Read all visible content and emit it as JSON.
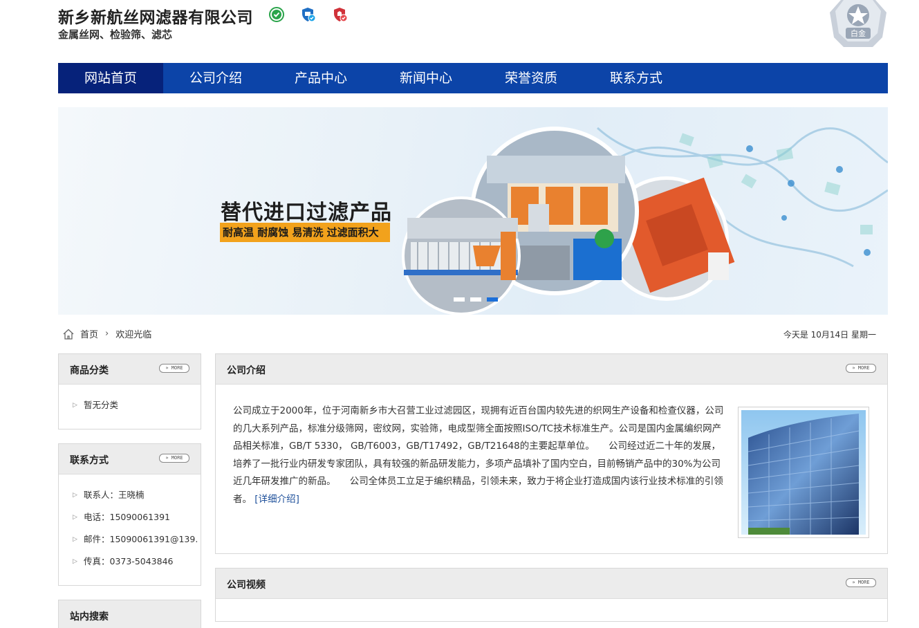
{
  "header": {
    "company_name": "新乡新航丝网滤器有限公司",
    "company_sub": "金属丝网、检验筛、滤芯",
    "badges": [
      "verified-green-icon",
      "shield-blue-icon",
      "shield-red-icon"
    ],
    "level_badge": "白金"
  },
  "nav": {
    "items": [
      {
        "label": "网站首页",
        "active": true
      },
      {
        "label": "公司介绍"
      },
      {
        "label": "产品中心"
      },
      {
        "label": "新闻中心"
      },
      {
        "label": "荣誉资质"
      },
      {
        "label": "联系方式"
      }
    ]
  },
  "banner": {
    "title": "替代进口过滤产品",
    "tagline": "耐高温 耐腐蚀 易清洗 过滤面积大",
    "slides_total": 3,
    "active_slide": 3
  },
  "breadcrumb": {
    "home": "首页",
    "current": "欢迎光临"
  },
  "date_text": "今天是 10月14日 星期一",
  "more_label": "MORE",
  "sidebar": {
    "categories": {
      "title": "商品分类",
      "items": [
        "暂无分类"
      ]
    },
    "contact": {
      "title": "联系方式",
      "items": [
        "联系人：王晓楠",
        "电话：15090061391",
        "邮件：15090061391@139.",
        "传真：0373-5043846"
      ]
    },
    "search": {
      "title": "站内搜索"
    }
  },
  "main": {
    "intro": {
      "title": "公司介绍",
      "text": "公司成立于2000年，位于河南新乡市大召营工业过滤园区，现拥有近百台国内较先进的织网生产设备和检查仪器，公司的几大系列产品，标准分级筛网，密纹网，实验筛，电成型筛全面按照ISO/TC技术标准生产。公司是国内金属编织网产品相关标准，GB/T 5330， GB/T6003，GB/T17492，GB/T21648的主要起草单位。　　公司经过近二十年的发展，培养了一批行业内研发专家团队，具有较强的新品研发能力，多项产品填补了国内空白，目前畅销产品中的30%为公司近几年研发推广的新品。　　公司全体员工立足于编织精品，引领未来，致力于将企业打造成国内该行业技术标准的引领者。",
      "more_link": "[详细介绍]"
    },
    "video": {
      "title": "公司视频"
    }
  },
  "colors": {
    "nav_bg": "#0c44a8",
    "nav_active": "#06227a",
    "banner_tag": "#f2a21c"
  }
}
